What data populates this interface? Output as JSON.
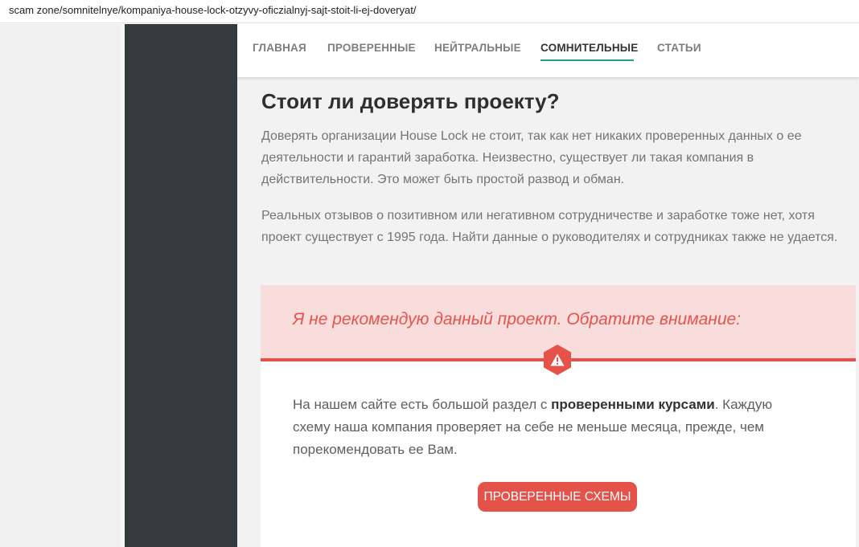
{
  "browser": {
    "url": "scam zone/somnitelnye/kompaniya-house-lock-otzyvy-oficzialnyj-sajt-stoit-li-ej-doveryat/"
  },
  "nav": {
    "items": [
      {
        "label": "ГЛАВНАЯ",
        "active": false
      },
      {
        "label": "ПРОВЕРЕННЫЕ",
        "active": false
      },
      {
        "label": "НЕЙТРАЛЬНЫЕ",
        "active": false
      },
      {
        "label": "СОМНИТЕЛЬНЫЕ",
        "active": true
      },
      {
        "label": "СТАТЬИ",
        "active": false
      }
    ],
    "accent_color": "#25a28a"
  },
  "article": {
    "heading": "Стоит ли доверять проекту?",
    "paragraphs": [
      "Доверять организации House Lock не стоит, так как нет никаких проверенных данных о ее деятельности и гарантий заработка. Неизвестно, существует ли такая компания в действительности. Это может быть простой развод и обман.",
      "Реальных отзывов о позитивном или негативном сотрудничестве и заработке тоже нет, хотя проект существует с 1995 года. Найти данные о руководителях и сотрудниках также не удается."
    ]
  },
  "notice": {
    "title": "Я не рекомендую данный проект. Обратите внимание:",
    "icon": "warning-icon",
    "body_before": "На нашем сайте есть большой раздел с ",
    "body_bold": "проверенными курсами",
    "body_after": ". Каждую схему наша компания проверяет на себе не меньше месяца, прежде, чем порекомендовать ее Вам.",
    "button_label": "ПРОВЕРЕННЫЕ СХЕМЫ",
    "accent_color": "#e5524a",
    "background_color": "#f9dcdc"
  }
}
